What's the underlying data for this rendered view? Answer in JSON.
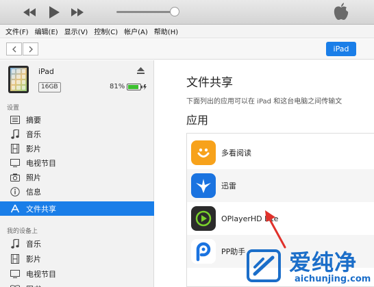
{
  "menubar": {
    "items": [
      "文件(F)",
      "编辑(E)",
      "显示(V)",
      "控制(C)",
      "帐户(A)",
      "帮助(H)"
    ]
  },
  "player": {
    "volume_level": 0.9
  },
  "nav": {
    "device_button": "iPad"
  },
  "device": {
    "name": "iPad",
    "capacity": "16GB",
    "battery": "81%"
  },
  "sidebar": {
    "settings_header": "设置",
    "settings_items": [
      {
        "label": "摘要",
        "icon": "summary-icon"
      },
      {
        "label": "音乐",
        "icon": "music-icon"
      },
      {
        "label": "影片",
        "icon": "film-icon"
      },
      {
        "label": "电视节目",
        "icon": "tv-icon"
      },
      {
        "label": "照片",
        "icon": "camera-icon"
      },
      {
        "label": "信息",
        "icon": "info-icon"
      },
      {
        "label": "文件共享",
        "icon": "app-store-icon",
        "active": true
      }
    ],
    "my_device_header": "我的设备上",
    "device_items": [
      {
        "label": "音乐",
        "icon": "music-icon"
      },
      {
        "label": "影片",
        "icon": "film-icon"
      },
      {
        "label": "电视节目",
        "icon": "tv-icon"
      },
      {
        "label": "图书",
        "icon": "book-icon"
      }
    ]
  },
  "main": {
    "title": "文件共享",
    "description": "下面列出的应用可以在 iPad 和这台电脑之间传输文",
    "apps_title": "应用",
    "apps": [
      {
        "name": "多看阅读",
        "icon": "duokan-icon"
      },
      {
        "name": "迅雷",
        "icon": "xunlei-icon"
      },
      {
        "name": "OPlayerHD Lite",
        "icon": "oplayer-icon"
      },
      {
        "name": "PP助手",
        "icon": "pp-assistant-icon"
      }
    ]
  },
  "watermark": {
    "text": "爱纯净",
    "url": "aichunjing.com"
  },
  "colors": {
    "accent": "#1a7ee8",
    "annotation_arrow": "#e0312b",
    "watermark": "#1b6ec9"
  }
}
